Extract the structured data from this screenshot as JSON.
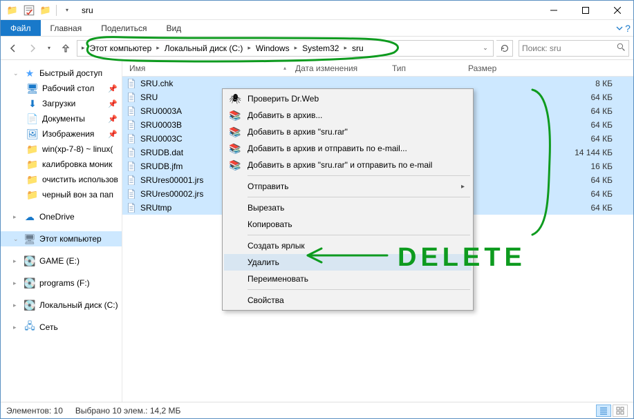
{
  "title": "sru",
  "ribbon": {
    "file": "Файл",
    "tabs": [
      "Главная",
      "Поделиться",
      "Вид"
    ]
  },
  "breadcrumbs": [
    "Этот компьютер",
    "Локальный диск (C:)",
    "Windows",
    "System32",
    "sru"
  ],
  "search_placeholder": "Поиск: sru",
  "columns": {
    "name": "Имя",
    "date": "Дата изменения",
    "type": "Тип",
    "size": "Размер"
  },
  "files": [
    {
      "name": "SRU.chk",
      "size": "8 КБ"
    },
    {
      "name": "SRU",
      "size": "64 КБ"
    },
    {
      "name": "SRU0003A",
      "size": "64 КБ"
    },
    {
      "name": "SRU0003B",
      "size": "64 КБ"
    },
    {
      "name": "SRU0003C",
      "size": "64 КБ"
    },
    {
      "name": "SRUDB.dat",
      "size": "14 144 КБ"
    },
    {
      "name": "SRUDB.jfm",
      "size": "16 КБ"
    },
    {
      "name": "SRUres00001.jrs",
      "size": "64 КБ"
    },
    {
      "name": "SRUres00002.jrs",
      "size": "64 КБ"
    },
    {
      "name": "SRUtmp",
      "size": "64 КБ"
    }
  ],
  "nav": {
    "quick": "Быстрый доступ",
    "desktop": "Рабочий стол",
    "downloads": "Загрузки",
    "documents": "Документы",
    "pictures": "Изображения",
    "f1": "win(xp-7-8) ~ linux(",
    "f2": "калибровка моник",
    "f3": "очистить использов",
    "f4": "черный вон за пап",
    "onedrive": "OneDrive",
    "thispc": "Этот компьютер",
    "game": "GAME (E:)",
    "programs": "programs (F:)",
    "localc": "Локальный диск (C:)",
    "network": "Сеть"
  },
  "context": {
    "drweb": "Проверить Dr.Web",
    "addarch": "Добавить в архив...",
    "addsru": "Добавить в архив \"sru.rar\"",
    "addemail": "Добавить в архив и отправить по e-mail...",
    "addsrumail": "Добавить в архив \"sru.rar\" и отправить по e-mail",
    "send": "Отправить",
    "cut": "Вырезать",
    "copy": "Копировать",
    "shortcut": "Создать ярлык",
    "delete": "Удалить",
    "rename": "Переименовать",
    "props": "Свойства"
  },
  "status": {
    "count": "Элементов: 10",
    "selected": "Выбрано 10 элем.: 14,2 МБ"
  },
  "annotation_text": "DELETE"
}
